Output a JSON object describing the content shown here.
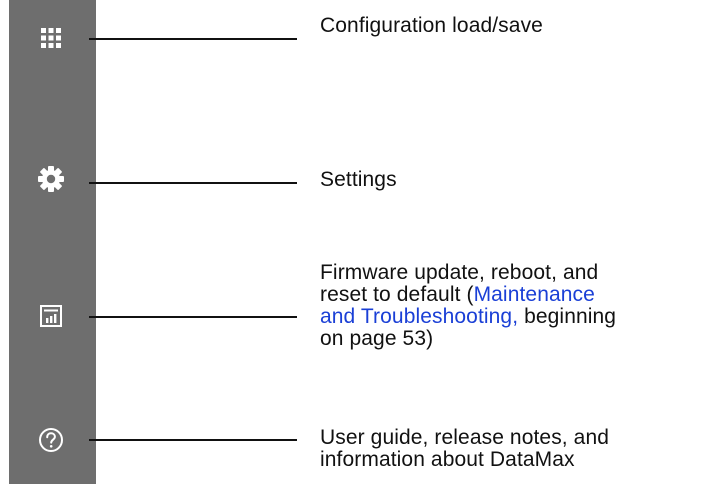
{
  "sidebar": {
    "background_color": "#6e6e6e",
    "icon_color": "#ffffff",
    "items": [
      {
        "icon": "grid-icon",
        "name": "configuration-load-save"
      },
      {
        "icon": "gear-icon",
        "name": "settings"
      },
      {
        "icon": "bar-chart-icon",
        "name": "maintenance"
      },
      {
        "icon": "help-circle-icon",
        "name": "help"
      }
    ]
  },
  "callouts": [
    {
      "text": "Configuration load/save"
    },
    {
      "text": "Settings"
    },
    {
      "line1": "Firmware update, reboot, and",
      "line2": "reset to default (",
      "link_part1": "Maintenance",
      "link_part2": "and Troubleshooting,",
      "line3_rest": " beginning",
      "line4": "on page 53)",
      "link_color": "#1a3fd6"
    },
    {
      "line1": "User guide, release notes, and",
      "line2": "information about DataMax"
    }
  ]
}
